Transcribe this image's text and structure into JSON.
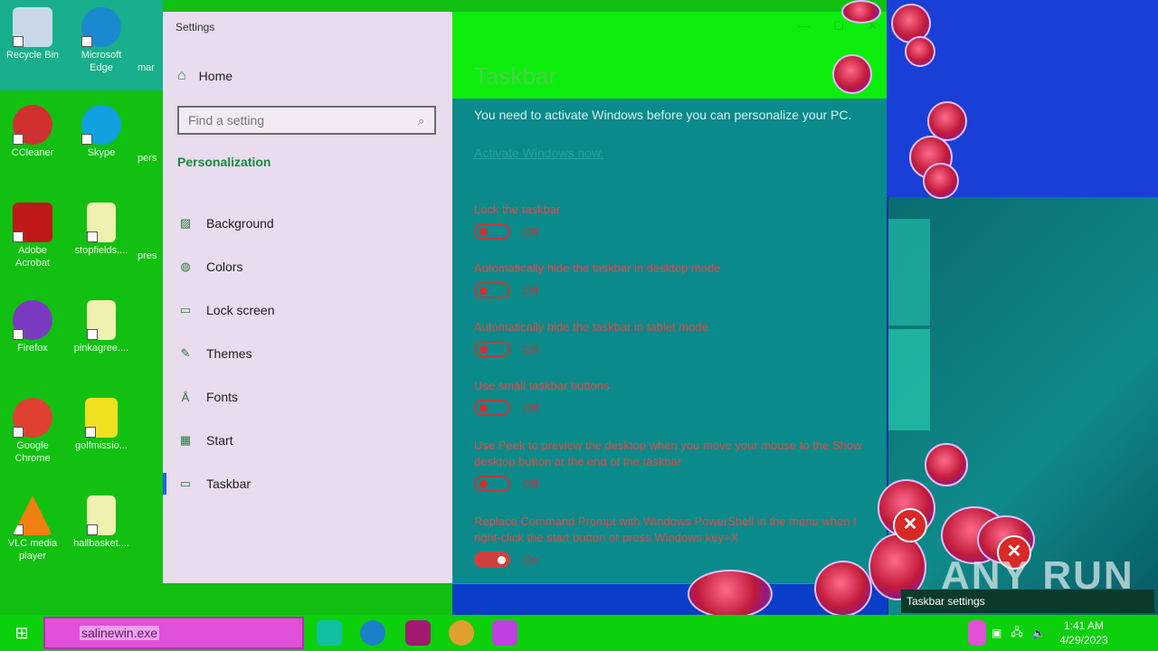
{
  "desktop_icons": [
    {
      "label": "Recycle Bin",
      "color": "#c8d8e8"
    },
    {
      "label": "Microsoft Edge",
      "color": "#1a8ad0"
    },
    {
      "label": "CCleaner",
      "color": "#d03030"
    },
    {
      "label": "Skype",
      "color": "#10a0e0"
    },
    {
      "label": "Adobe Acrobat",
      "color": "#c01818"
    },
    {
      "label": "stopfields....",
      "color": "#f0f0b0"
    },
    {
      "label": "Firefox",
      "color": "#7a3ac0"
    },
    {
      "label": "pinkagree....",
      "color": "#f0f0b0"
    },
    {
      "label": "Google Chrome",
      "color": "#e04030"
    },
    {
      "label": "golfmissio...",
      "color": "#f0e020"
    },
    {
      "label": "VLC media player",
      "color": "#f08010"
    },
    {
      "label": "hallbasket....",
      "color": "#f0f0b0"
    }
  ],
  "partial_icons": [
    "mar",
    "pers",
    "pres"
  ],
  "window": {
    "title": "Settings",
    "home_label": "Home",
    "search_placeholder": "Find a setting",
    "section": "Personalization",
    "nav": [
      {
        "label": "Background",
        "icon": "image-icon"
      },
      {
        "label": "Colors",
        "icon": "palette-icon"
      },
      {
        "label": "Lock screen",
        "icon": "lock-screen-icon"
      },
      {
        "label": "Themes",
        "icon": "themes-icon"
      },
      {
        "label": "Fonts",
        "icon": "fonts-icon"
      },
      {
        "label": "Start",
        "icon": "start-icon"
      },
      {
        "label": "Taskbar",
        "icon": "taskbar-icon",
        "active": true
      }
    ],
    "page_title": "Taskbar",
    "notice": "You need to activate Windows before you can personalize your PC.",
    "activate_link": "Activate Windows now.",
    "options": [
      {
        "label": "Lock the taskbar",
        "state": "Off",
        "on": false
      },
      {
        "label": "Automatically hide the taskbar in desktop mode",
        "state": "Off",
        "on": false
      },
      {
        "label": "Automatically hide the taskbar in tablet mode",
        "state": "Off",
        "on": false
      },
      {
        "label": "Use small taskbar buttons",
        "state": "Off",
        "on": false
      },
      {
        "label": "Use Peek to preview the desktop when you move your mouse to the Show desktop button at the end of the taskbar",
        "state": "Off",
        "on": false
      },
      {
        "label": "Replace Command Prompt with Windows PowerShell in the menu when I right-click the start button or press Windows key+X",
        "state": "On",
        "on": true
      }
    ]
  },
  "tooltip": "Taskbar settings",
  "watermark": "ANY RUN",
  "taskbar": {
    "search_text": "salinewin.exe",
    "time": "1:41 AM",
    "date": "4/29/2023"
  }
}
